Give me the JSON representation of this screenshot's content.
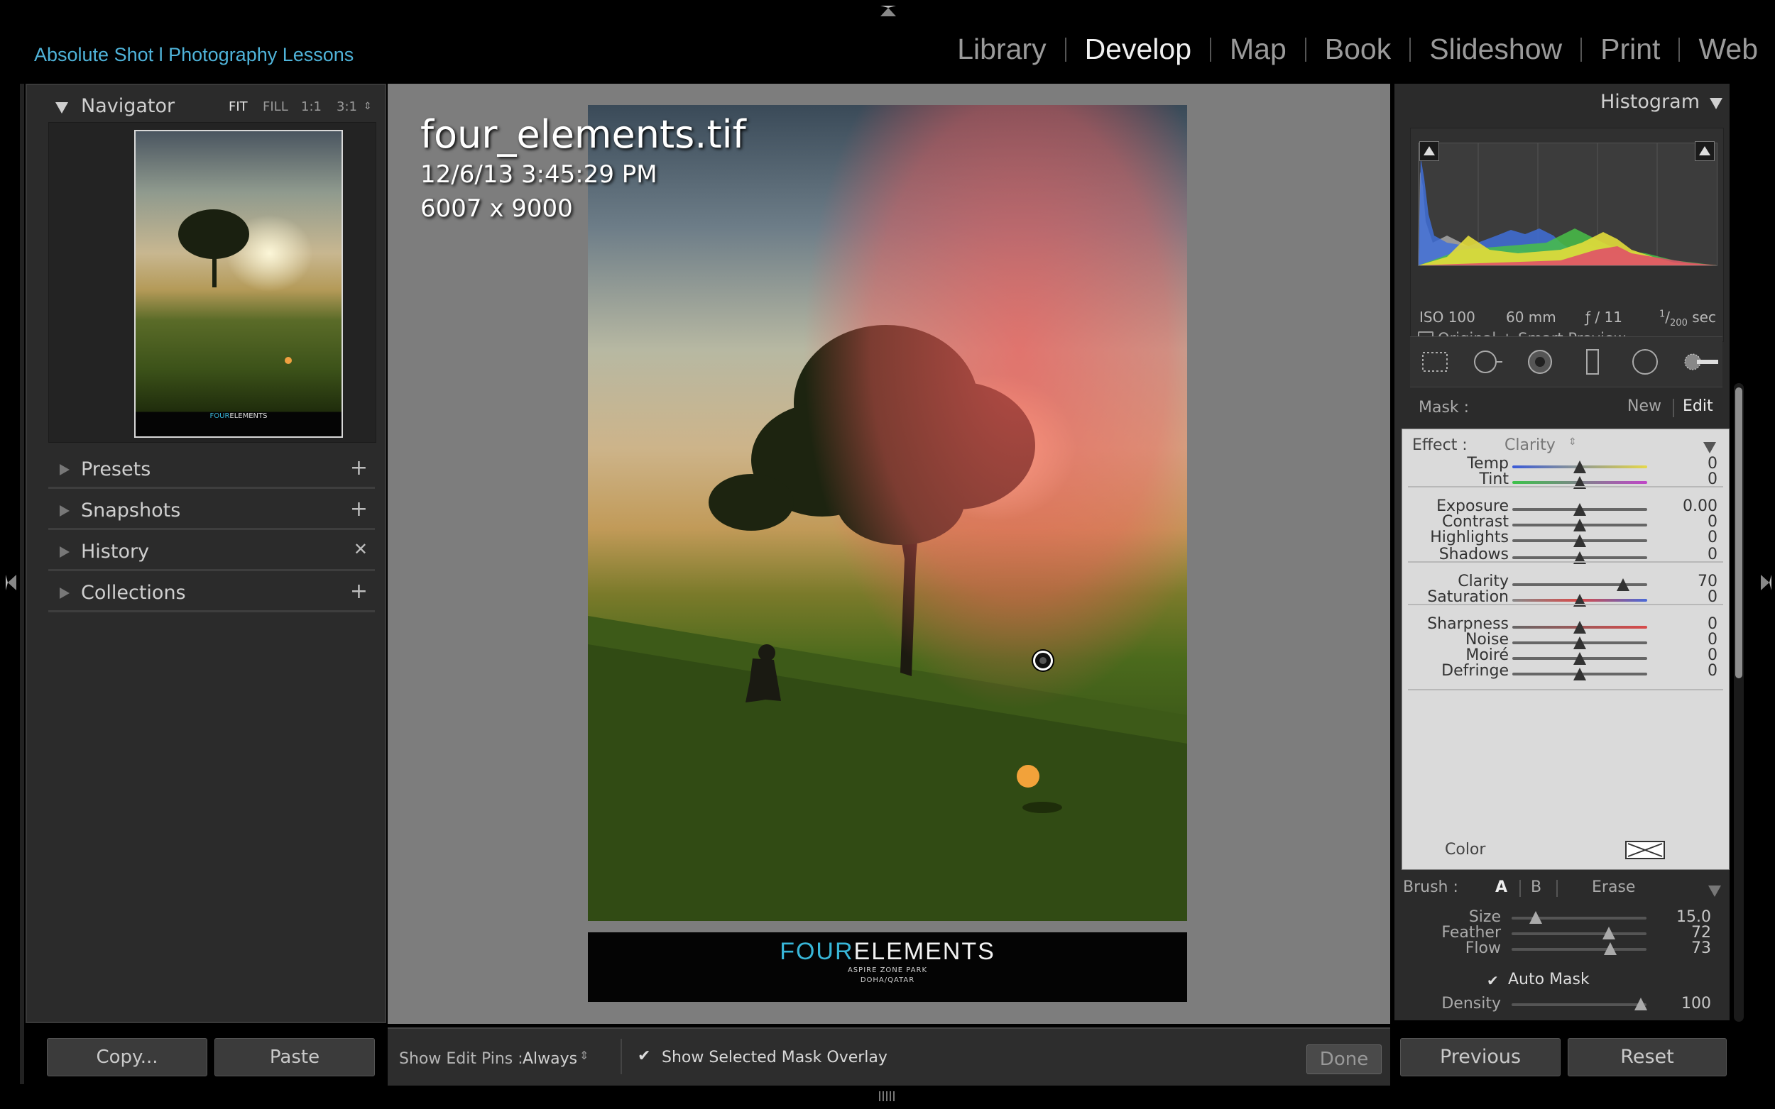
{
  "identity_plate": "Absolute Shot l Photography Lessons",
  "modules": [
    "Library",
    "Develop",
    "Map",
    "Book",
    "Slideshow",
    "Print",
    "Web"
  ],
  "active_module": "Develop",
  "left_panel": {
    "navigator": {
      "title": "Navigator",
      "zoom_options": [
        "FIT",
        "FILL",
        "1:1",
        "3:1"
      ],
      "selected_zoom": "FIT"
    },
    "sections": [
      {
        "label": "Presets",
        "action_icon": "plus-icon"
      },
      {
        "label": "Snapshots",
        "action_icon": "plus-icon"
      },
      {
        "label": "History",
        "action_icon": "clear-x-icon"
      },
      {
        "label": "Collections",
        "action_icon": "plus-icon"
      }
    ],
    "copy_label": "Copy...",
    "paste_label": "Paste"
  },
  "image_info": {
    "filename": "four_elements.tif",
    "datetime": "12/6/13 3:45:29 PM",
    "dimensions": "6007 x 9000"
  },
  "photo": {
    "logo_prefix": "FOUR",
    "logo_suffix": "ELEMENTS",
    "logo_line1": "ASPIRE ZONE PARK",
    "logo_line2": "DOHA/QATAR",
    "logo_accent_color": "#38b6d8"
  },
  "toolbar": {
    "show_pins_label": "Show Edit Pins :",
    "show_pins_value": "Always",
    "mask_overlay_label": "Show Selected Mask Overlay",
    "mask_overlay_checked": true,
    "done_label": "Done"
  },
  "right_panel": {
    "histogram": {
      "title": "Histogram",
      "iso": "ISO 100",
      "focal": "60 mm",
      "aperture": "ƒ / 11",
      "shutter_num": "1",
      "shutter_den": "200",
      "shutter_unit": "sec",
      "preview_label": "Original + Smart Preview"
    },
    "tools": [
      "crop-overlay-icon",
      "spot-removal-icon",
      "red-eye-icon",
      "graduated-filter-icon",
      "radial-filter-icon",
      "adjustment-brush-icon"
    ],
    "mask": {
      "label": "Mask :",
      "new_label": "New",
      "edit_label": "Edit"
    },
    "effect": {
      "label": "Effect :",
      "value": "Clarity",
      "sliders": [
        {
          "label": "Temp",
          "value": "0",
          "pos": 0.5
        },
        {
          "label": "Tint",
          "value": "0",
          "pos": 0.5
        },
        {
          "label": "Exposure",
          "value": "0.00",
          "pos": 0.5
        },
        {
          "label": "Contrast",
          "value": "0",
          "pos": 0.5
        },
        {
          "label": "Highlights",
          "value": "0",
          "pos": 0.5
        },
        {
          "label": "Shadows",
          "value": "0",
          "pos": 0.5
        },
        {
          "label": "Clarity",
          "value": "70",
          "pos": 0.82
        },
        {
          "label": "Saturation",
          "value": "0",
          "pos": 0.5
        },
        {
          "label": "Sharpness",
          "value": "0",
          "pos": 0.5
        },
        {
          "label": "Noise",
          "value": "0",
          "pos": 0.5
        },
        {
          "label": "Moiré",
          "value": "0",
          "pos": 0.5
        },
        {
          "label": "Defringe",
          "value": "0",
          "pos": 0.5
        }
      ],
      "color_label": "Color"
    },
    "brush": {
      "label": "Brush :",
      "options": [
        "A",
        "B",
        "Erase"
      ],
      "selected": "A",
      "sliders": [
        {
          "label": "Size",
          "value": "15.0",
          "pos": 0.18
        },
        {
          "label": "Feather",
          "value": "72",
          "pos": 0.72
        },
        {
          "label": "Flow",
          "value": "73",
          "pos": 0.73
        }
      ],
      "auto_mask_label": "Auto Mask",
      "auto_mask_checked": true,
      "density_label": "Density",
      "density_value": "100",
      "density_pos": 0.96
    },
    "previous_label": "Previous",
    "reset_label": "Reset"
  }
}
